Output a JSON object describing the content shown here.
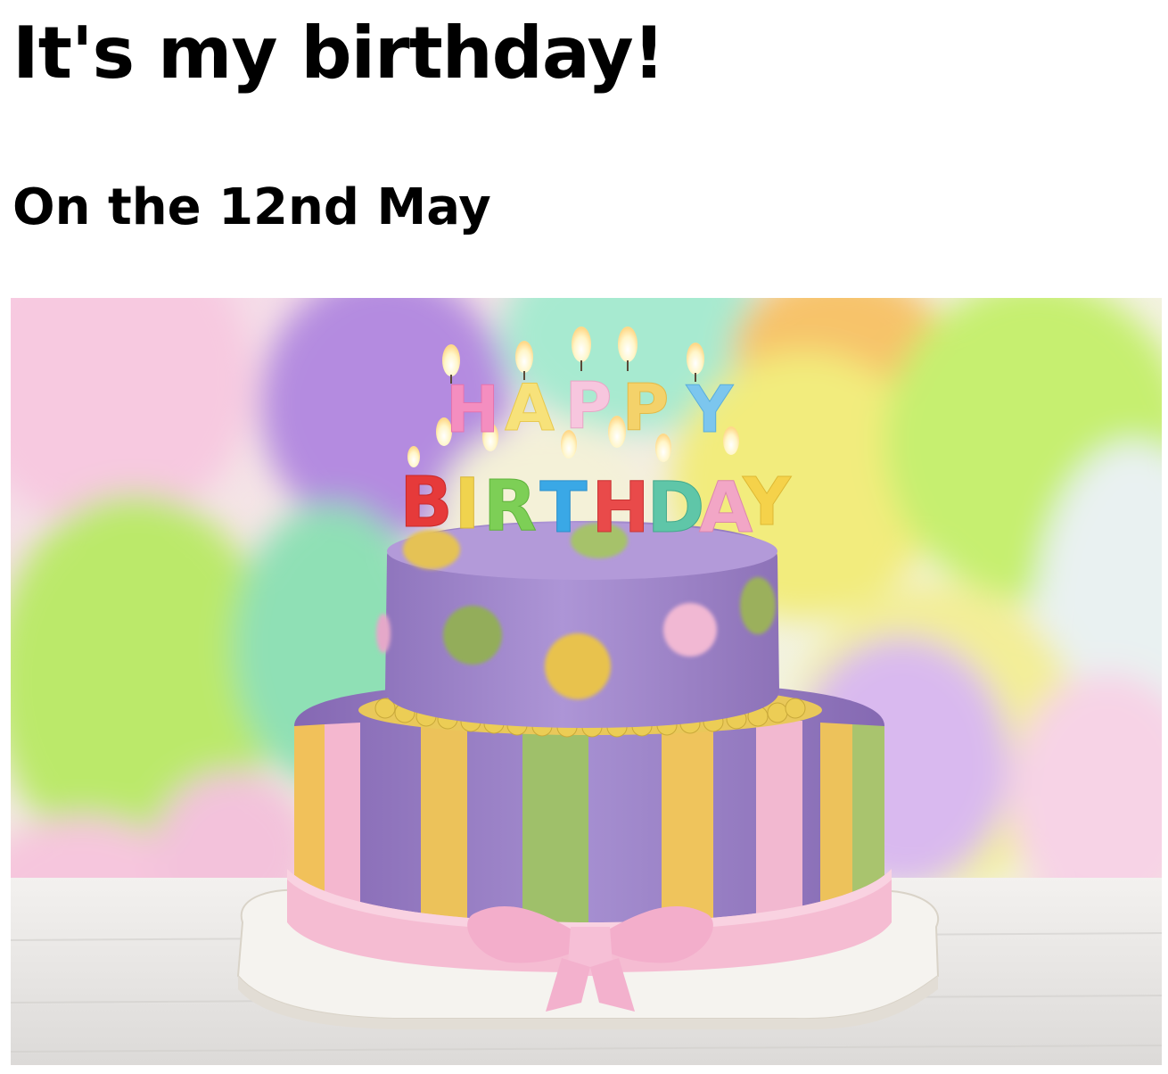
{
  "page": {
    "title": "It's my birthday!",
    "subtitle": "On the 12nd May"
  },
  "image": {
    "subject": "birthday-cake-photo",
    "candle_letters": "HAPPY BIRTHDAY",
    "colors": {
      "lavender": "#a98fd1",
      "pink": "#f4b7cf",
      "yellow": "#e9c45a",
      "green": "#9cc068",
      "white": "#f7f4f2"
    }
  }
}
